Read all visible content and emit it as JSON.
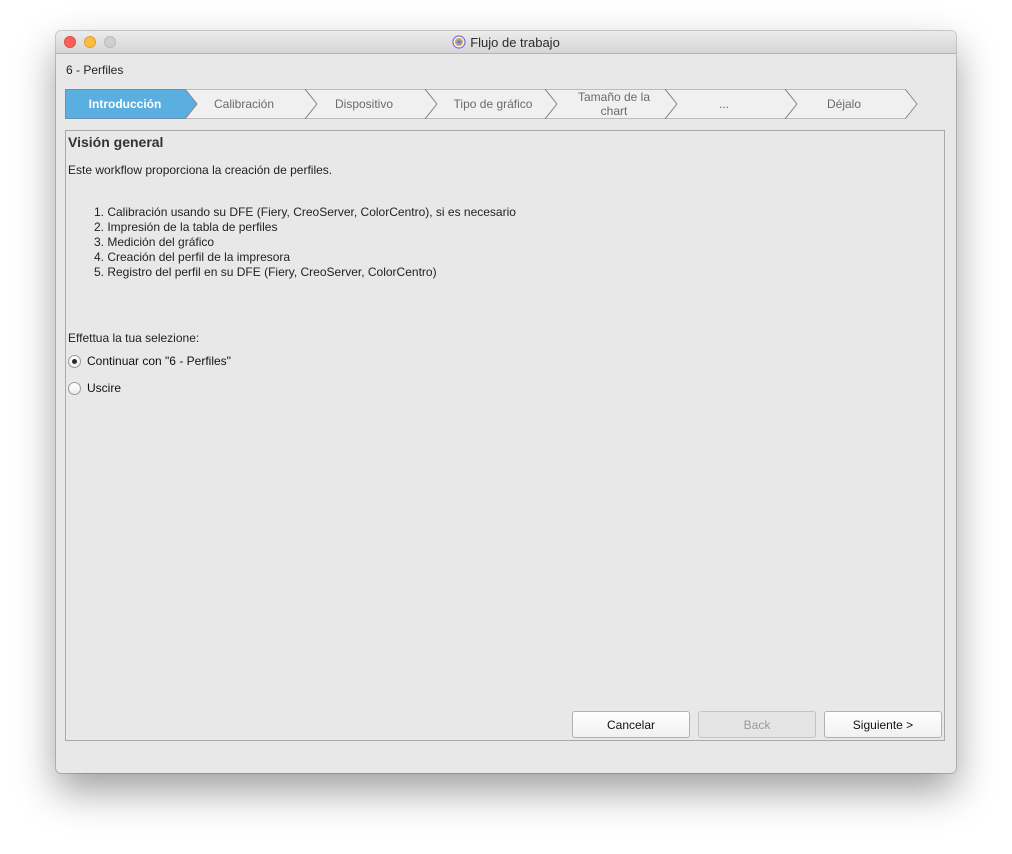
{
  "window": {
    "title": "Flujo de trabajo",
    "subtitle": "6 - Perfiles"
  },
  "icons": {
    "close": "close-icon",
    "minimize": "minimize-icon",
    "maximize": "maximize-icon",
    "app": "app-icon"
  },
  "colors": {
    "active_step": "#5aaee0",
    "inactive_step": "#f0f0f0",
    "step_border": "#8a8a8a"
  },
  "steps": [
    {
      "label": "Introducción",
      "active": true
    },
    {
      "label": "Calibración",
      "active": false
    },
    {
      "label": "Dispositivo",
      "active": false
    },
    {
      "label": "Tipo de gráfico",
      "active": false
    },
    {
      "label": "Tamaño de la chart",
      "active": false
    },
    {
      "label": "...",
      "active": false
    },
    {
      "label": "Déjalo",
      "active": false
    }
  ],
  "panel": {
    "title": "Visión general",
    "intro": "Este workflow proporciona la creación de perfiles.",
    "list": [
      "1. Calibración usando su DFE (Fiery, CreoServer, ColorCentro), si es necesario",
      "2. Impresión de la tabla de perfiles",
      "3. Medición del gráfico",
      "4. Creación del perfil de la impresora",
      "5. Registro del perfil en su DFE (Fiery, CreoServer, ColorCentro)"
    ],
    "prompt": "Effettua la tua selezione:",
    "options": [
      {
        "label": "Continuar con \"6 - Perfiles\"",
        "selected": true
      },
      {
        "label": "Uscire",
        "selected": false
      }
    ]
  },
  "buttons": {
    "cancel": "Cancelar",
    "back": "Back",
    "next": "Siguiente >"
  }
}
